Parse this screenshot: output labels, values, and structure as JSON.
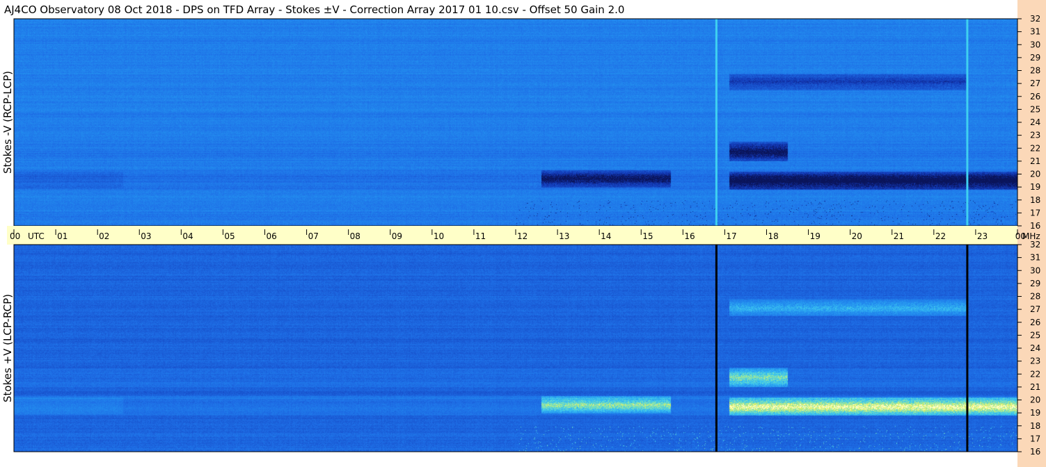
{
  "header": {
    "title": "AJ4CO Observatory  08 Oct 2018  -  DPS on TFD Array  -  Stokes ±V  -  Correction Array 2017 01 10.csv  -  Offset 50  Gain 2.0"
  },
  "chart_data": {
    "type": "heatmap",
    "title": "AJ4CO Observatory  08 Oct 2018  -  DPS on TFD Array  -  Stokes ±V  -  Correction Array 2017 01 10.csv  -  Offset 50  Gain 2.0",
    "x_unit_label": "UTC",
    "y_unit_label": "MHz",
    "x_ticks": [
      "00",
      "01",
      "02",
      "03",
      "04",
      "05",
      "06",
      "07",
      "08",
      "09",
      "10",
      "11",
      "12",
      "13",
      "14",
      "15",
      "16",
      "17",
      "18",
      "19",
      "20",
      "21",
      "22",
      "23",
      "00"
    ],
    "xlim_hours": [
      0,
      24
    ],
    "y_ticks_mhz": [
      "16",
      "17",
      "18",
      "19",
      "20",
      "21",
      "22",
      "23",
      "24",
      "25",
      "26",
      "27",
      "28",
      "29",
      "30",
      "31",
      "32"
    ],
    "ylim_mhz": [
      16,
      32
    ],
    "grid": false,
    "panels": [
      {
        "name": "top",
        "ylabel": "Stokes -V (RCP-LCP)",
        "base_color": "#1f86e6",
        "events": [
          {
            "start_hr": 12.6,
            "end_hr": 15.7,
            "f_lo": 19,
            "f_hi": 20.3,
            "level": -0.45
          },
          {
            "start_hr": 17.1,
            "end_hr": 24,
            "f_lo": 18.8,
            "f_hi": 20.2,
            "level": -0.55
          },
          {
            "start_hr": 17.1,
            "end_hr": 18.5,
            "f_lo": 21,
            "f_hi": 22.5,
            "level": -0.5
          },
          {
            "start_hr": 17.1,
            "end_hr": 22.8,
            "f_lo": 26.5,
            "f_hi": 27.8,
            "level": -0.3
          }
        ],
        "vertical_lines_hr": [
          16.8,
          22.8
        ],
        "vertical_line_color": "#3fd0f0"
      },
      {
        "name": "bottom",
        "ylabel": "Stokes +V (LCP-RCP)",
        "base_color": "#1a6fd8",
        "events": [
          {
            "start_hr": 12.6,
            "end_hr": 15.7,
            "f_lo": 19,
            "f_hi": 20.3,
            "level": 0.45
          },
          {
            "start_hr": 17.1,
            "end_hr": 24,
            "f_lo": 18.8,
            "f_hi": 20.2,
            "level": 0.6
          },
          {
            "start_hr": 17.1,
            "end_hr": 18.5,
            "f_lo": 21,
            "f_hi": 22.5,
            "level": 0.45
          },
          {
            "start_hr": 17.1,
            "end_hr": 22.8,
            "f_lo": 26.5,
            "f_hi": 27.8,
            "level": 0.3
          }
        ],
        "vertical_lines_hr": [
          16.8,
          22.8
        ],
        "vertical_line_color": "#000000"
      }
    ],
    "colors": {
      "axis_band": "#ffffc8",
      "right_band": "#fbd8b8",
      "frame": "#000000"
    }
  }
}
